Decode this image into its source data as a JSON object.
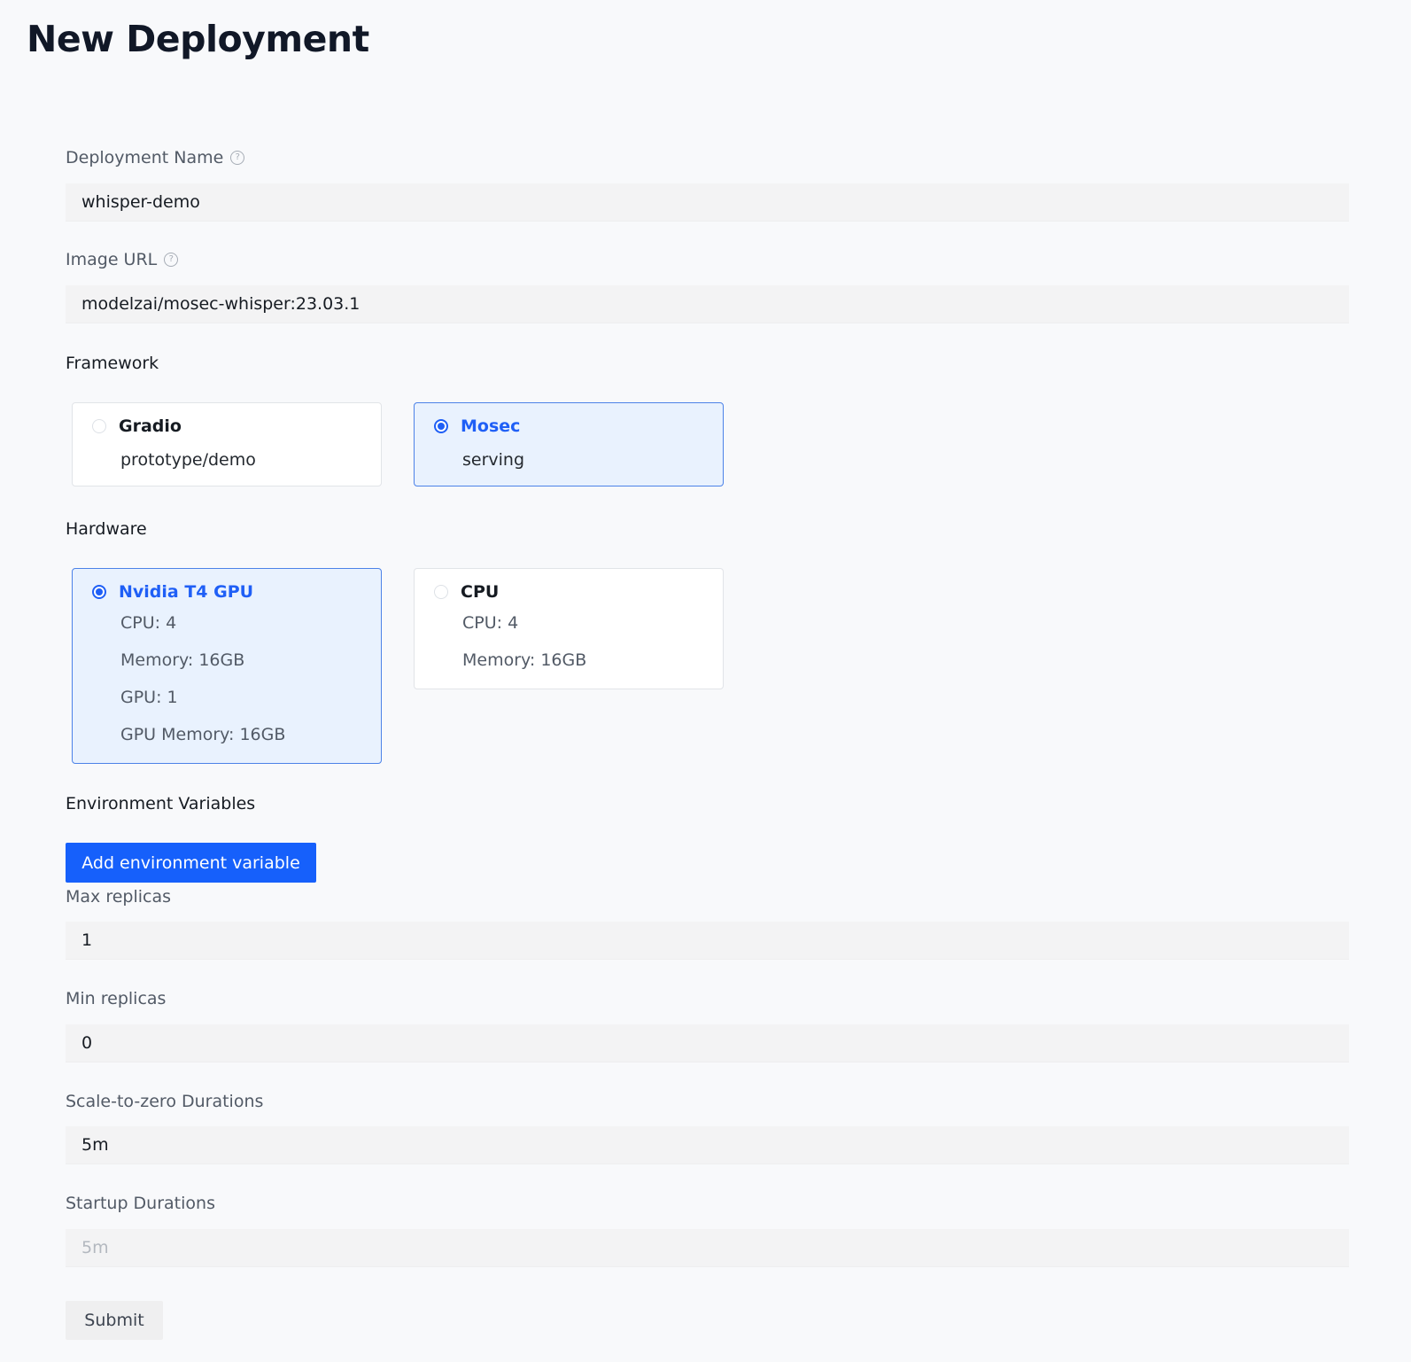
{
  "page": {
    "title": "New Deployment"
  },
  "fields": {
    "deployment_name": {
      "label": "Deployment Name",
      "value": "whisper-demo"
    },
    "image_url": {
      "label": "Image URL",
      "value": "modelzai/mosec-whisper:23.03.1"
    },
    "max_replicas": {
      "label": "Max replicas",
      "value": "1"
    },
    "min_replicas": {
      "label": "Min replicas",
      "value": "0"
    },
    "scale_to_zero": {
      "label": "Scale-to-zero Durations",
      "value": "5m"
    },
    "startup": {
      "label": "Startup Durations",
      "value": "",
      "placeholder": "5m"
    }
  },
  "framework": {
    "label": "Framework",
    "options": [
      {
        "title": "Gradio",
        "subtitle": "prototype/demo",
        "selected": false
      },
      {
        "title": "Mosec",
        "subtitle": "serving",
        "selected": true
      }
    ]
  },
  "hardware": {
    "label": "Hardware",
    "options": [
      {
        "title": "Nvidia T4 GPU",
        "specs": [
          "CPU: 4",
          "Memory: 16GB",
          "GPU: 1",
          "GPU Memory: 16GB"
        ],
        "selected": true
      },
      {
        "title": "CPU",
        "specs": [
          "CPU: 4",
          "Memory: 16GB"
        ],
        "selected": false
      }
    ]
  },
  "env": {
    "label": "Environment Variables",
    "add_button": "Add environment variable"
  },
  "submit_label": "Submit",
  "colors": {
    "accent": "#1660fb",
    "selected_bg": "#e9f2fe"
  },
  "icons": {
    "help": "help-circle-icon"
  }
}
